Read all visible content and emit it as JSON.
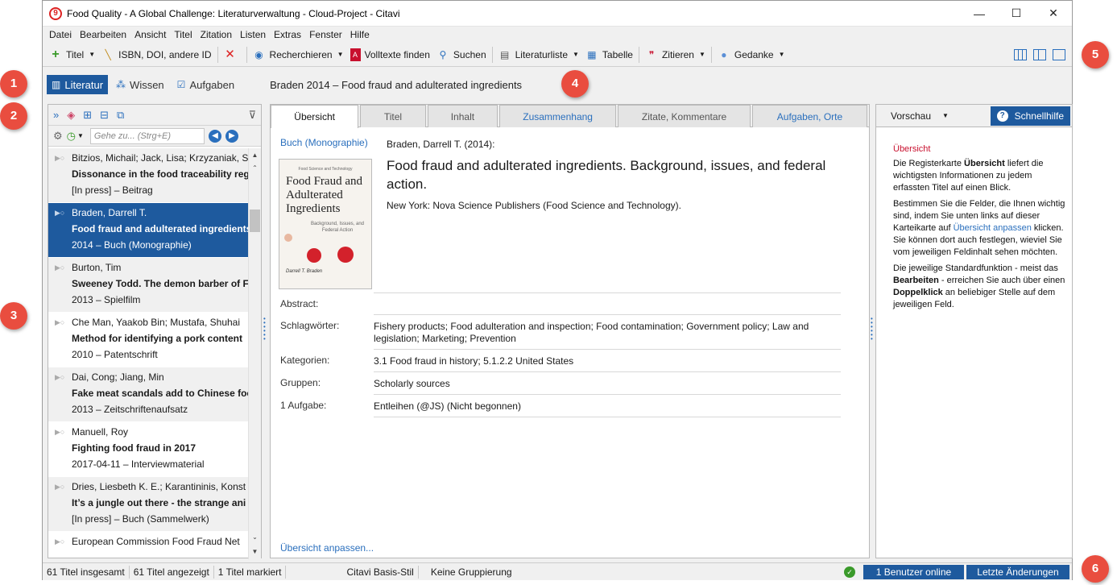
{
  "window": {
    "title": "Food Quality - A Global Challenge: Literaturverwaltung - Cloud-Project - Citavi",
    "min": "—",
    "max": "☐",
    "close": "✕"
  },
  "menu": [
    "Datei",
    "Bearbeiten",
    "Ansicht",
    "Titel",
    "Zitation",
    "Listen",
    "Extras",
    "Fenster",
    "Hilfe"
  ],
  "toolbar": {
    "titel": "Titel",
    "isbn": "ISBN, DOI, andere ID",
    "recherchieren": "Recherchieren",
    "volltexte": "Volltexte finden",
    "suchen": "Suchen",
    "literaturliste": "Literaturliste",
    "tabelle": "Tabelle",
    "zitieren": "Zitieren",
    "gedanke": "Gedanke"
  },
  "nav": {
    "literatur": "Literatur",
    "wissen": "Wissen",
    "aufgaben": "Aufgaben",
    "record_title": "Braden 2014 – Food fraud and adulterated ingredients"
  },
  "search": {
    "placeholder": "Gehe zu... (Strg+E)"
  },
  "list": [
    {
      "l1": "Bitzios, Michail; Jack, Lisa; Krzyzaniak, S",
      "l2": "Dissonance in the food traceability reg",
      "l3": "[In press] – Beitrag"
    },
    {
      "l1": "Braden, Darrell T.",
      "l2": "Food fraud and adulterated ingredients",
      "l3": "2014 – Buch (Monographie)"
    },
    {
      "l1": "Burton, Tim",
      "l2": "Sweeney Todd. The demon barber of Fl",
      "l3": "2013 – Spielfilm"
    },
    {
      "l1": "Che Man, Yaakob Bin; Mustafa, Shuhai",
      "l2": "Method for identifying a pork content",
      "l3": "2010 – Patentschrift"
    },
    {
      "l1": "Dai, Cong; Jiang, Min",
      "l2": "Fake meat scandals add to Chinese foo",
      "l3": "2013 – Zeitschriftenaufsatz"
    },
    {
      "l1": "Manuell, Roy",
      "l2": "Fighting food fraud in 2017",
      "l3": "2017-04-11 – Interviewmaterial"
    },
    {
      "l1": "Dries, Liesbeth K. E.; Karantininis, Konst",
      "l2": "It’s a jungle out there - the strange ani",
      "l3": "[In press] – Buch (Sammelwerk)"
    },
    {
      "l1": "European Commission Food Fraud Net",
      "l2": "",
      "l3": ""
    }
  ],
  "tabs": [
    "Übersicht",
    "Titel",
    "Inhalt",
    "Zusammenhang",
    "Zitate, Kommentare",
    "Aufgaben, Orte"
  ],
  "record": {
    "type": "Buch (Monographie)",
    "author_line": "Braden, Darrell T. (2014):",
    "title": "Food fraud and adulterated ingredients. Background, issues, and federal action.",
    "publisher": "New York: Nova Science Publishers (Food Science and Technology).",
    "cover": {
      "series": "Food Science and Technology",
      "title": "Food Fraud and Adulterated Ingredients",
      "subtitle": "Background, Issues, and Federal Action",
      "author": "Darrell T. Braden"
    },
    "fields": [
      {
        "label": "Abstract:",
        "value": ""
      },
      {
        "label": "Schlagwörter:",
        "value": "Fishery products; Food adulteration and inspection; Food contamination; Government policy; Law and legislation; Marketing; Prevention"
      },
      {
        "label": "Kategorien:",
        "value": "3.1 Food fraud in history; 5.1.2.2 United States"
      },
      {
        "label": "Gruppen:",
        "value": "Scholarly sources"
      },
      {
        "label": "1 Aufgabe:",
        "value": "Entleihen (@JS) (Nicht begonnen)"
      }
    ],
    "customize_link": "Übersicht anpassen..."
  },
  "preview": {
    "label": "Vorschau",
    "help_button": "Schnellhilfe",
    "heading": "Übersicht",
    "p1a": "Die Registerkarte ",
    "p1b": "Übersicht",
    "p1c": " liefert die wichtigsten Informationen zu jedem erfassten Titel auf einen Blick.",
    "p2a": "Bestimmen Sie die Felder, die Ihnen wichtig sind, indem Sie unten links auf dieser Karteikarte auf ",
    "p2link": "Übersicht anpassen",
    "p2c": " klicken. Sie können dort auch festlegen, wieviel Sie vom jeweiligen Feldinhalt sehen möchten.",
    "p3a": "Die jeweilige Standardfunktion - meist das ",
    "p3b": "Bearbeiten",
    "p3c": " - erreichen Sie auch über einen ",
    "p3d": "Doppelklick",
    "p3e": " an beliebiger Stelle auf dem jeweiligen Feld."
  },
  "status": {
    "total": "61 Titel insgesamt",
    "shown": "61 Titel angezeigt",
    "marked": "1 Titel markiert",
    "style": "Citavi Basis-Stil",
    "grouping": "Keine Gruppierung",
    "online": "1 Benutzer online",
    "changes": "Letzte Änderungen"
  },
  "callouts": [
    "1",
    "2",
    "3",
    "4",
    "5",
    "6"
  ],
  "colors": {
    "accent": "#1e5a9e",
    "callout": "#e94d3f",
    "link": "#2a6fbd"
  }
}
